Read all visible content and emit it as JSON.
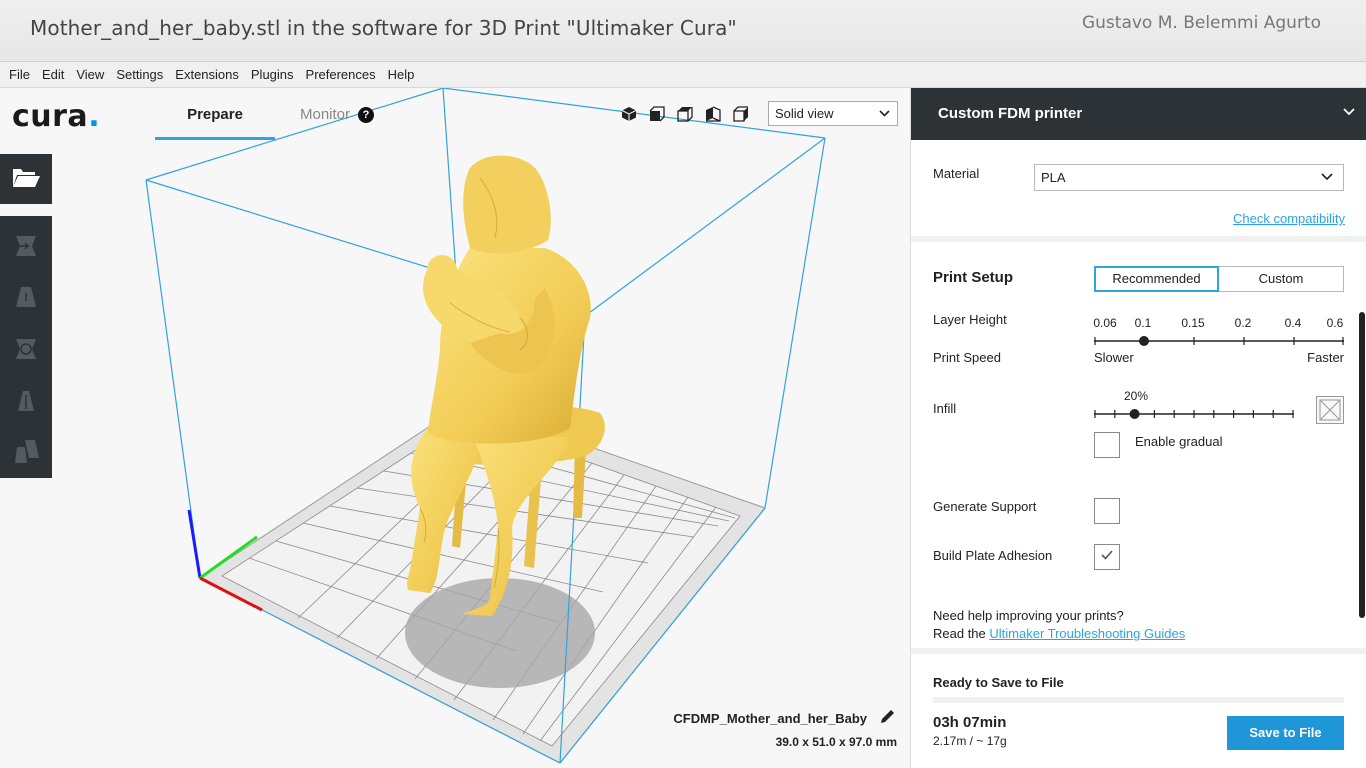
{
  "window": {
    "title": "Mother_and_her_baby.stl in the software for 3D Print \"Ultimaker Cura\"",
    "author": "Gustavo M. Belemmi Agurto"
  },
  "menu": [
    "File",
    "Edit",
    "View",
    "Settings",
    "Extensions",
    "Plugins",
    "Preferences",
    "Help"
  ],
  "header": {
    "logo": "cura",
    "logo_dot": ".",
    "tabs": {
      "prepare": "Prepare",
      "monitor": "Monitor"
    },
    "help": "?",
    "view_mode": "Solid view"
  },
  "view_buttons": [
    "3d-view-icon",
    "front-view-icon",
    "top-view-icon",
    "left-view-icon",
    "right-view-icon"
  ],
  "toolbar": [
    "open-file-icon",
    "move-tool-icon",
    "scale-tool-icon",
    "rotate-tool-icon",
    "mirror-tool-icon",
    "per-model-settings-icon"
  ],
  "model": {
    "name": "CFDMP_Mother_and_her_Baby",
    "dimensions": "39.0 x 51.0 x 97.0 mm"
  },
  "sidebar": {
    "printer": "Custom FDM printer",
    "material_label": "Material",
    "material_value": "PLA",
    "check_compat": "Check compatibility",
    "print_setup": "Print Setup",
    "mode_recommended": "Recommended",
    "mode_custom": "Custom",
    "layer_height_label": "Layer Height",
    "layer_height_ticks": [
      "0.06",
      "0.1",
      "0.15",
      "0.2",
      "0.4",
      "0.6"
    ],
    "layer_height_selected": "0.1",
    "print_speed_label": "Print Speed",
    "slower": "Slower",
    "faster": "Faster",
    "infill_label": "Infill",
    "infill_value": "20%",
    "infill_fraction": 0.2,
    "enable_gradual": "Enable gradual",
    "gradual_checked": false,
    "generate_support": "Generate Support",
    "support_checked": false,
    "build_plate_adhesion": "Build Plate Adhesion",
    "adhesion_checked": true,
    "help_line1": "Need help improving your prints?",
    "help_read": "Read the ",
    "help_link": "Ultimaker Troubleshooting Guides"
  },
  "output": {
    "status": "Ready to Save to File",
    "time": "03h 07min",
    "material": "2.17m / ~ 17g",
    "save_button": "Save to File"
  },
  "colors": {
    "accent": "#31a3dd",
    "dark_panel": "#2d3237",
    "model": "#f4d162",
    "build_volume": "#31a3dd"
  }
}
